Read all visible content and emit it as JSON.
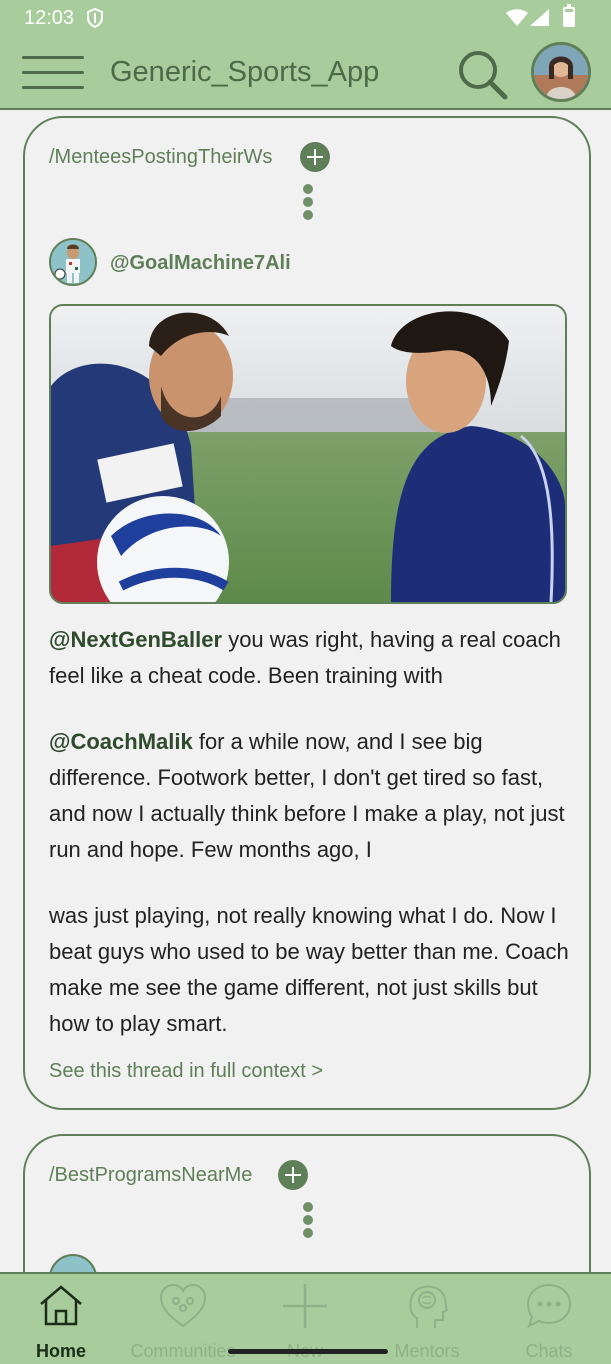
{
  "status_bar": {
    "time": "12:03",
    "icons": [
      "shield-icon",
      "wifi-icon",
      "signal-icon",
      "battery-icon"
    ]
  },
  "app_bar": {
    "title": "Generic_Sports_App",
    "icons": [
      "menu-icon",
      "search-icon",
      "profile-avatar"
    ]
  },
  "colors": {
    "accent": "#a9cc9d",
    "dark_green": "#5f7f58",
    "text": "#222222",
    "background": "#f1f1f1"
  },
  "posts": [
    {
      "community": "/MenteesPostingTheirWs",
      "author": "@GoalMachine7Ali",
      "paragraphs": [
        {
          "mention": "@NextGenBaller",
          "text": " you was right, having a real coach feel like a cheat code. Been training with"
        },
        {
          "mention": "@CoachMalik",
          "text": " for a while now, and I see big difference. Footwork better, I don't get tired so fast, and now I actually think before I make a play, not just run and hope. Few months ago, I"
        },
        {
          "mention": "",
          "text": "was just playing, not really knowing what I do. Now I beat guys who used to be way better than me. Coach make me see the game different, not just skills but how to play smart."
        }
      ],
      "thread_link": "See this thread in full context >"
    },
    {
      "community": "/BestProgramsNearMe"
    }
  ],
  "bottom_nav": {
    "items": [
      {
        "label": "Home",
        "icon": "home-icon",
        "active": true
      },
      {
        "label": "Communities",
        "icon": "heart-people-icon",
        "active": false
      },
      {
        "label": "New",
        "icon": "plus-icon",
        "active": false
      },
      {
        "label": "Mentors",
        "icon": "brain-head-icon",
        "active": false
      },
      {
        "label": "Chats",
        "icon": "chat-bubble-icon",
        "active": false
      }
    ]
  }
}
